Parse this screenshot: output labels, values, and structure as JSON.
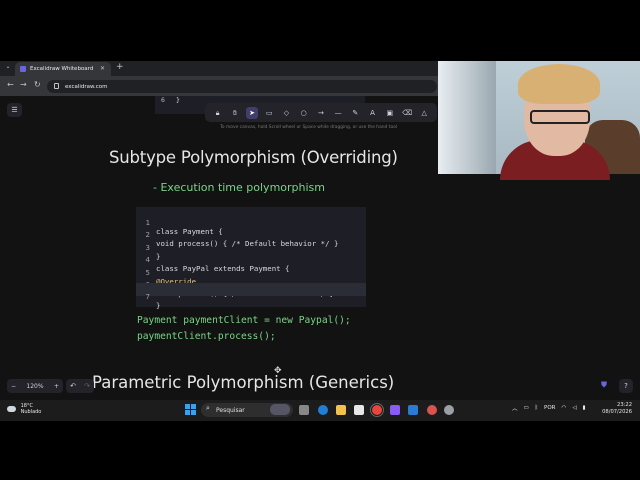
{
  "browser": {
    "tab_title": "Excalidraw Whiteboard",
    "url": "excalidraw.com"
  },
  "canvas": {
    "hint": "To move canvas, hold Scroll wheel or Space while dragging, or use the hand tool",
    "top_code": {
      "line": "6",
      "text": "}"
    },
    "title1": "Subtype Polymorphism (Overriding)",
    "subtitle1": "- Execution time polymorphism",
    "code": [
      {
        "n": "1",
        "text": "class Payment {"
      },
      {
        "n": "2",
        "text": "void process() { /* Default behavior */ }"
      },
      {
        "n": "3",
        "text": "}"
      },
      {
        "n": "4",
        "text": "class PayPal extends Payment {"
      },
      {
        "n": "5",
        "text": "@Override"
      },
      {
        "n": "6",
        "text": "void process() { /* Custom behavior */ }"
      },
      {
        "n": "7",
        "text": "}"
      }
    ],
    "usage_line1": "Payment paymentClient = new Paypal();",
    "usage_line2": "paymentClient.process();",
    "title2": "Parametric Polymorphism (Generics)"
  },
  "zoom": {
    "level": "120%",
    "minus": "−",
    "plus": "+"
  },
  "taskbar": {
    "weather_temp": "18°C",
    "weather_text": "Nublado",
    "search_placeholder": "Pesquisar",
    "lang": "POR",
    "time": "23:22",
    "date": "08/07/2026"
  },
  "colors": {
    "accent": "#6965db",
    "green_text": "#7bd389"
  }
}
